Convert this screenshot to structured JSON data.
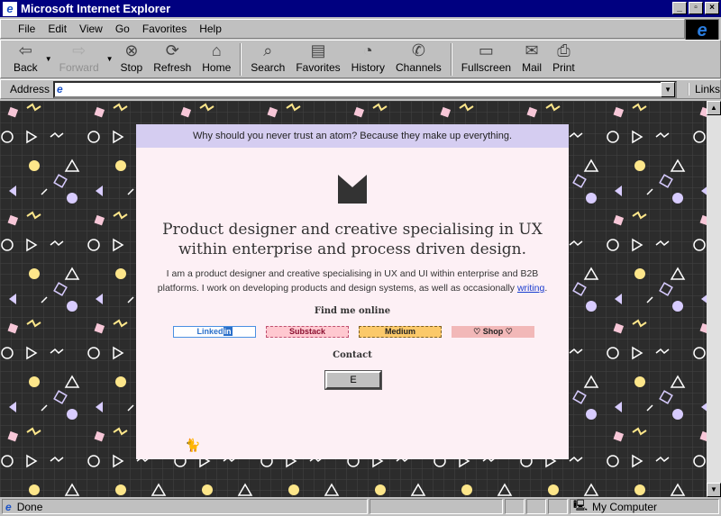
{
  "window": {
    "title": "Microsoft Internet Explorer",
    "min": "_",
    "max": "▫",
    "close": "×"
  },
  "menu": [
    "File",
    "Edit",
    "View",
    "Go",
    "Favorites",
    "Help"
  ],
  "toolbar": [
    {
      "label": "Back",
      "glyph": "⇦",
      "disabled": false
    },
    {
      "label": "Forward",
      "glyph": "⇨",
      "disabled": true
    },
    {
      "label": "Stop",
      "glyph": "⊗"
    },
    {
      "label": "Refresh",
      "glyph": "⟳"
    },
    {
      "label": "Home",
      "glyph": "⌂"
    },
    {
      "label": "Search",
      "glyph": "⌕"
    },
    {
      "label": "Favorites",
      "glyph": "▤"
    },
    {
      "label": "History",
      "glyph": "◔"
    },
    {
      "label": "Channels",
      "glyph": "✆"
    },
    {
      "label": "Fullscreen",
      "glyph": "▭"
    },
    {
      "label": "Mail",
      "glyph": "✉"
    },
    {
      "label": "Print",
      "glyph": "⎙"
    }
  ],
  "address": {
    "label": "Address",
    "value": "",
    "links": "Links"
  },
  "page": {
    "joke": "Why should you never trust an atom? Because they make up everything.",
    "headline": "Product designer and creative specialising in UX within enterprise and process driven design.",
    "intro": "I am a product designer and creative specialising in UX and UI within enterprise and B2B platforms. I work on developing products and design systems, as well as occasionally ",
    "writing_link": "writing",
    "intro_end": ".",
    "find_heading": "Find me online",
    "badges": [
      {
        "label": "Linked",
        "label2": "in",
        "bg": "#ffffff",
        "border": "#4a90e2",
        "color": "#2a6fc9"
      },
      {
        "label": "Substack",
        "bg": "#ffc8d0",
        "border": "#c05070",
        "color": "#8a1030"
      },
      {
        "label": "Medium",
        "bg": "#fbc96a",
        "border": "#806020",
        "color": "#222222"
      },
      {
        "label": "♡ Shop ♡",
        "bg": "#f2b8b8",
        "border": "#f2b8b8",
        "color": "#222222"
      }
    ],
    "contact_heading": "Contact",
    "contact_button": "E"
  },
  "status": {
    "text": "Done",
    "zone": "My Computer"
  }
}
